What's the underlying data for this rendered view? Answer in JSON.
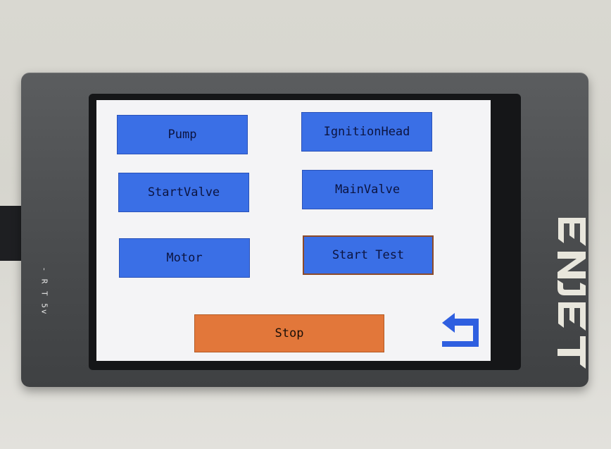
{
  "device": {
    "side_label": "- R T 5v",
    "brand_logo_text": "ENJET"
  },
  "screen": {
    "buttons": {
      "pump": "Pump",
      "ignition_head": "IgnitionHead",
      "start_valve": "StartValve",
      "main_valve": "MainValve",
      "motor": "Motor",
      "start_test": "Start Test",
      "stop": "Stop"
    },
    "back_icon": "return-arrow-icon"
  },
  "colors": {
    "button_blue": "#3a6fe6",
    "stop_orange": "#e2773a",
    "screen_bg": "#f4f4f6"
  }
}
